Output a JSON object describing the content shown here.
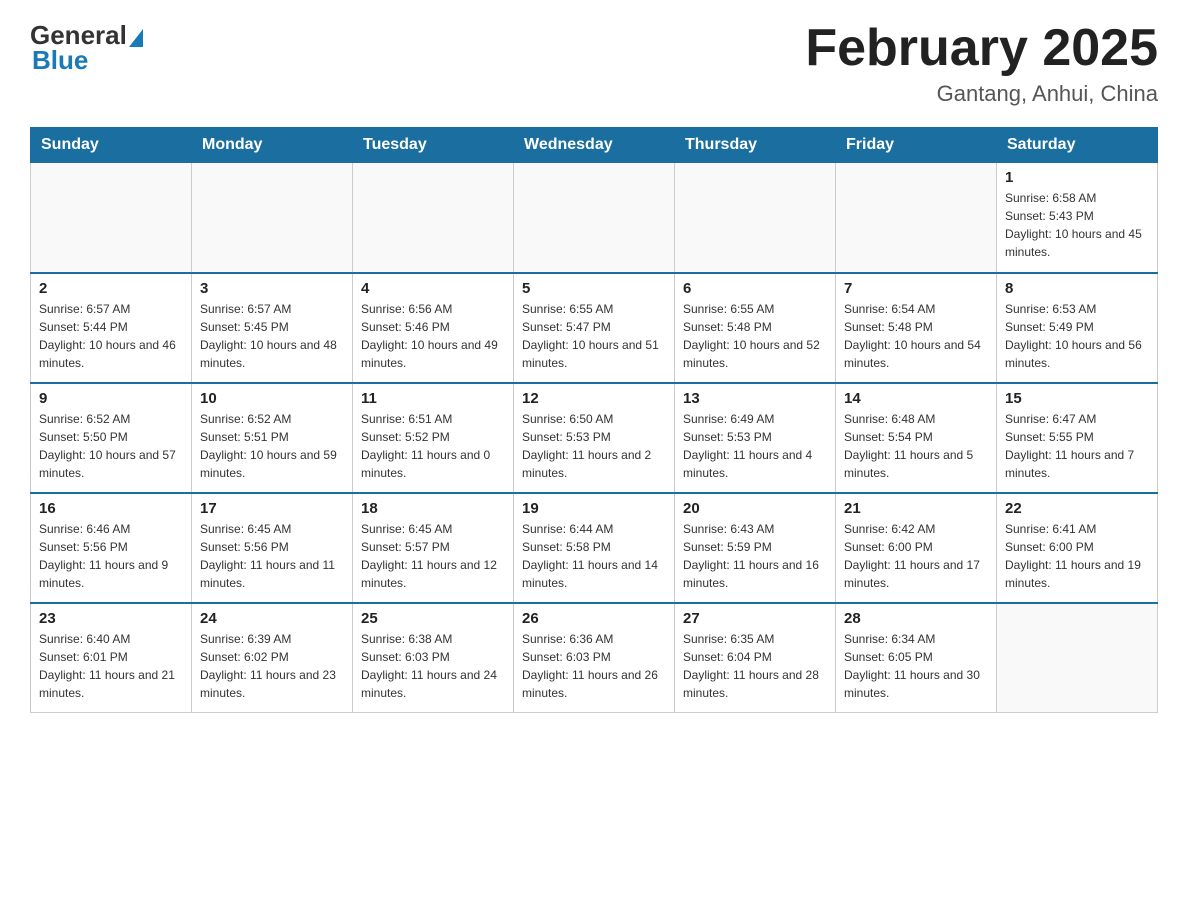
{
  "header": {
    "logo": {
      "general": "General",
      "blue": "Blue"
    },
    "title": "February 2025",
    "location": "Gantang, Anhui, China"
  },
  "days_of_week": [
    "Sunday",
    "Monday",
    "Tuesday",
    "Wednesday",
    "Thursday",
    "Friday",
    "Saturday"
  ],
  "weeks": [
    {
      "days": [
        {
          "num": "",
          "info": ""
        },
        {
          "num": "",
          "info": ""
        },
        {
          "num": "",
          "info": ""
        },
        {
          "num": "",
          "info": ""
        },
        {
          "num": "",
          "info": ""
        },
        {
          "num": "",
          "info": ""
        },
        {
          "num": "1",
          "info": "Sunrise: 6:58 AM\nSunset: 5:43 PM\nDaylight: 10 hours and 45 minutes."
        }
      ]
    },
    {
      "days": [
        {
          "num": "2",
          "info": "Sunrise: 6:57 AM\nSunset: 5:44 PM\nDaylight: 10 hours and 46 minutes."
        },
        {
          "num": "3",
          "info": "Sunrise: 6:57 AM\nSunset: 5:45 PM\nDaylight: 10 hours and 48 minutes."
        },
        {
          "num": "4",
          "info": "Sunrise: 6:56 AM\nSunset: 5:46 PM\nDaylight: 10 hours and 49 minutes."
        },
        {
          "num": "5",
          "info": "Sunrise: 6:55 AM\nSunset: 5:47 PM\nDaylight: 10 hours and 51 minutes."
        },
        {
          "num": "6",
          "info": "Sunrise: 6:55 AM\nSunset: 5:48 PM\nDaylight: 10 hours and 52 minutes."
        },
        {
          "num": "7",
          "info": "Sunrise: 6:54 AM\nSunset: 5:48 PM\nDaylight: 10 hours and 54 minutes."
        },
        {
          "num": "8",
          "info": "Sunrise: 6:53 AM\nSunset: 5:49 PM\nDaylight: 10 hours and 56 minutes."
        }
      ]
    },
    {
      "days": [
        {
          "num": "9",
          "info": "Sunrise: 6:52 AM\nSunset: 5:50 PM\nDaylight: 10 hours and 57 minutes."
        },
        {
          "num": "10",
          "info": "Sunrise: 6:52 AM\nSunset: 5:51 PM\nDaylight: 10 hours and 59 minutes."
        },
        {
          "num": "11",
          "info": "Sunrise: 6:51 AM\nSunset: 5:52 PM\nDaylight: 11 hours and 0 minutes."
        },
        {
          "num": "12",
          "info": "Sunrise: 6:50 AM\nSunset: 5:53 PM\nDaylight: 11 hours and 2 minutes."
        },
        {
          "num": "13",
          "info": "Sunrise: 6:49 AM\nSunset: 5:53 PM\nDaylight: 11 hours and 4 minutes."
        },
        {
          "num": "14",
          "info": "Sunrise: 6:48 AM\nSunset: 5:54 PM\nDaylight: 11 hours and 5 minutes."
        },
        {
          "num": "15",
          "info": "Sunrise: 6:47 AM\nSunset: 5:55 PM\nDaylight: 11 hours and 7 minutes."
        }
      ]
    },
    {
      "days": [
        {
          "num": "16",
          "info": "Sunrise: 6:46 AM\nSunset: 5:56 PM\nDaylight: 11 hours and 9 minutes."
        },
        {
          "num": "17",
          "info": "Sunrise: 6:45 AM\nSunset: 5:56 PM\nDaylight: 11 hours and 11 minutes."
        },
        {
          "num": "18",
          "info": "Sunrise: 6:45 AM\nSunset: 5:57 PM\nDaylight: 11 hours and 12 minutes."
        },
        {
          "num": "19",
          "info": "Sunrise: 6:44 AM\nSunset: 5:58 PM\nDaylight: 11 hours and 14 minutes."
        },
        {
          "num": "20",
          "info": "Sunrise: 6:43 AM\nSunset: 5:59 PM\nDaylight: 11 hours and 16 minutes."
        },
        {
          "num": "21",
          "info": "Sunrise: 6:42 AM\nSunset: 6:00 PM\nDaylight: 11 hours and 17 minutes."
        },
        {
          "num": "22",
          "info": "Sunrise: 6:41 AM\nSunset: 6:00 PM\nDaylight: 11 hours and 19 minutes."
        }
      ]
    },
    {
      "days": [
        {
          "num": "23",
          "info": "Sunrise: 6:40 AM\nSunset: 6:01 PM\nDaylight: 11 hours and 21 minutes."
        },
        {
          "num": "24",
          "info": "Sunrise: 6:39 AM\nSunset: 6:02 PM\nDaylight: 11 hours and 23 minutes."
        },
        {
          "num": "25",
          "info": "Sunrise: 6:38 AM\nSunset: 6:03 PM\nDaylight: 11 hours and 24 minutes."
        },
        {
          "num": "26",
          "info": "Sunrise: 6:36 AM\nSunset: 6:03 PM\nDaylight: 11 hours and 26 minutes."
        },
        {
          "num": "27",
          "info": "Sunrise: 6:35 AM\nSunset: 6:04 PM\nDaylight: 11 hours and 28 minutes."
        },
        {
          "num": "28",
          "info": "Sunrise: 6:34 AM\nSunset: 6:05 PM\nDaylight: 11 hours and 30 minutes."
        },
        {
          "num": "",
          "info": ""
        }
      ]
    }
  ]
}
